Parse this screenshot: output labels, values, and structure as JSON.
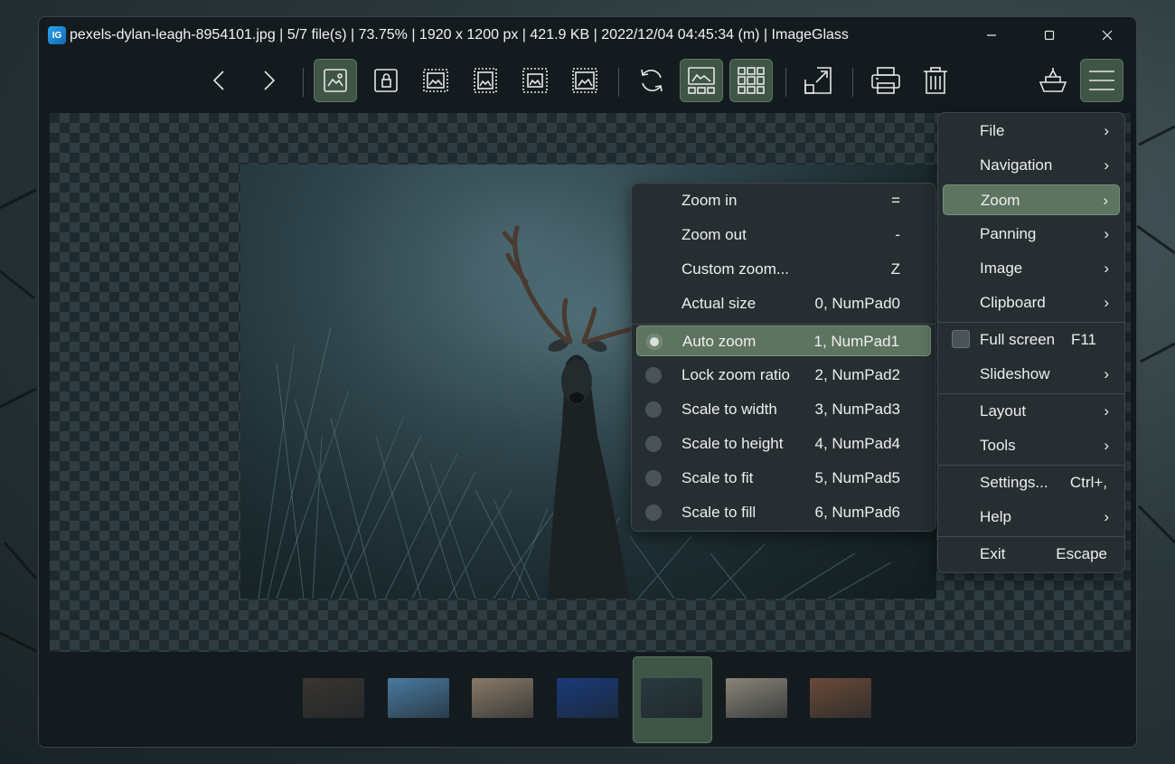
{
  "window": {
    "title": "pexels-dylan-leagh-8954101.jpg  |  5/7 file(s)  |  73.75%  |  1920 x 1200 px  |  421.9 KB  |  2022/12/04 04:45:34 (m)  |  ImageGlass",
    "app_icon_text": "IG"
  },
  "toolbar": {
    "items": [
      {
        "name": "previous-image-button",
        "icon": "chevron-left-icon",
        "active": false
      },
      {
        "name": "next-image-button",
        "icon": "chevron-right-icon",
        "active": false
      },
      {
        "name": "auto-zoom-button",
        "icon": "auto-zoom-icon",
        "active": true
      },
      {
        "name": "lock-zoom-ratio-button",
        "icon": "lock-image-icon",
        "active": false
      },
      {
        "name": "scale-to-width-button",
        "icon": "scale-width-icon",
        "active": false
      },
      {
        "name": "scale-to-height-button",
        "icon": "scale-height-icon",
        "active": false
      },
      {
        "name": "scale-to-fit-button",
        "icon": "scale-fit-icon",
        "active": false
      },
      {
        "name": "scale-to-fill-button",
        "icon": "scale-fill-icon",
        "active": false
      },
      {
        "name": "refresh-button",
        "icon": "refresh-icon",
        "active": false
      },
      {
        "name": "gallery-button",
        "icon": "gallery-icon",
        "active": true
      },
      {
        "name": "checkerboard-button",
        "icon": "grid-icon",
        "active": true
      },
      {
        "name": "fullscreen-button",
        "icon": "expand-icon",
        "active": false
      },
      {
        "name": "print-button",
        "icon": "printer-icon",
        "active": false
      },
      {
        "name": "delete-button",
        "icon": "trash-icon",
        "active": false
      },
      {
        "name": "plugins-button",
        "icon": "boat-icon",
        "active": false
      },
      {
        "name": "main-menu-button",
        "icon": "hamburger-icon",
        "active": true
      }
    ]
  },
  "main_menu": {
    "items": [
      {
        "label": "File",
        "shortcut": "",
        "submenu": true
      },
      {
        "label": "Navigation",
        "shortcut": "",
        "submenu": true
      },
      {
        "label": "Zoom",
        "shortcut": "",
        "submenu": true,
        "highlighted": true
      },
      {
        "label": "Panning",
        "shortcut": "",
        "submenu": true
      },
      {
        "label": "Image",
        "shortcut": "",
        "submenu": true
      },
      {
        "label": "Clipboard",
        "shortcut": "",
        "submenu": true
      },
      {
        "label": "Full screen",
        "shortcut": "F11",
        "submenu": false,
        "checkbox": true,
        "checked": false
      },
      {
        "label": "Slideshow",
        "shortcut": "",
        "submenu": true
      },
      {
        "label": "Layout",
        "shortcut": "",
        "submenu": true
      },
      {
        "label": "Tools",
        "shortcut": "",
        "submenu": true
      },
      {
        "label": "Settings...",
        "shortcut": "Ctrl+,",
        "submenu": false
      },
      {
        "label": "Help",
        "shortcut": "",
        "submenu": true
      },
      {
        "label": "Exit",
        "shortcut": "Escape",
        "submenu": false
      }
    ],
    "chevron": "›"
  },
  "zoom_menu": {
    "items": [
      {
        "label": "Zoom in",
        "shortcut": "="
      },
      {
        "label": "Zoom out",
        "shortcut": "-"
      },
      {
        "label": "Custom zoom...",
        "shortcut": "Z"
      },
      {
        "label": "Actual size",
        "shortcut": "0, NumPad0"
      },
      {
        "label": "Auto zoom",
        "shortcut": "1, NumPad1",
        "radio": true,
        "selected": true
      },
      {
        "label": "Lock zoom ratio",
        "shortcut": "2, NumPad2",
        "radio": true,
        "selected": false
      },
      {
        "label": "Scale to width",
        "shortcut": "3, NumPad3",
        "radio": true,
        "selected": false
      },
      {
        "label": "Scale to height",
        "shortcut": "4, NumPad4",
        "radio": true,
        "selected": false
      },
      {
        "label": "Scale to fit",
        "shortcut": "5, NumPad5",
        "radio": true,
        "selected": false
      },
      {
        "label": "Scale to fill",
        "shortcut": "6, NumPad6",
        "radio": true,
        "selected": false
      }
    ]
  },
  "thumbnails": {
    "count": 7,
    "selected_index": 4,
    "colors": [
      "#3a3530",
      "#4a7aa0",
      "#8a7a68",
      "#1a3a7a",
      "#2a3a40",
      "#8a8478",
      "#6a4a38"
    ]
  },
  "colors": {
    "accent_active": "#3f5546",
    "menu_highlight": "#5d7460",
    "window_bg": "#141b1f"
  }
}
